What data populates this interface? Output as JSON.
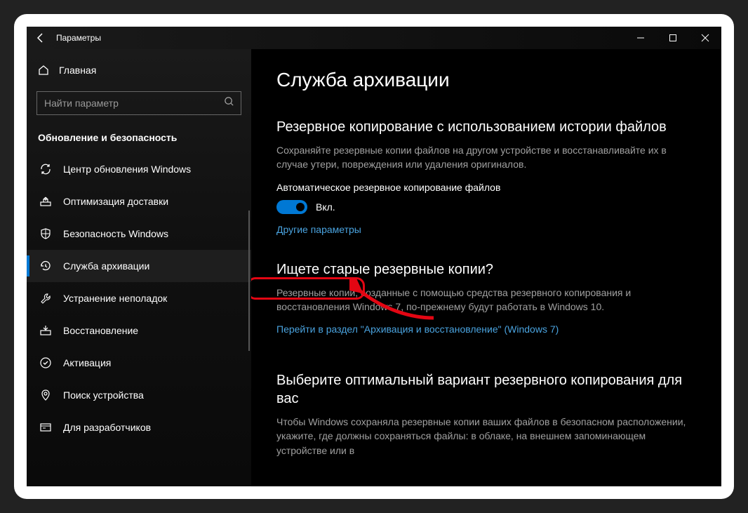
{
  "window": {
    "title": "Параметры"
  },
  "sidebar": {
    "home_label": "Главная",
    "search_placeholder": "Найти параметр",
    "category": "Обновление и безопасность",
    "items": [
      {
        "label": "Центр обновления Windows"
      },
      {
        "label": "Оптимизация доставки"
      },
      {
        "label": "Безопасность Windows"
      },
      {
        "label": "Служба архивации"
      },
      {
        "label": "Устранение неполадок"
      },
      {
        "label": "Восстановление"
      },
      {
        "label": "Активация"
      },
      {
        "label": "Поиск устройства"
      },
      {
        "label": "Для разработчиков"
      }
    ],
    "active_index": 3
  },
  "main": {
    "page_title": "Служба архивации",
    "section1": {
      "title": "Резервное копирование с использованием истории файлов",
      "desc": "Сохраняйте резервные копии файлов на другом устройстве и восстанавливайте их в случае утери, повреждения или удаления оригиналов.",
      "toggle_label": "Автоматическое резервное копирование файлов",
      "toggle_state": "Вкл.",
      "link": "Другие параметры"
    },
    "section2": {
      "title": "Ищете старые резервные копии?",
      "desc": "Резервные копии, созданные с помощью средства резервного копирования и восстановления Windows 7, по-прежнему будут работать в Windows 10.",
      "link": "Перейти в раздел \"Архивация и восстановление\" (Windows 7)"
    },
    "section3": {
      "title": "Выберите оптимальный вариант резервного копирования для вас",
      "desc": "Чтобы Windows сохраняла резервные копии ваших файлов в безопасном расположении, укажите, где должны сохраняться файлы: в облаке, на внешнем запоминающем устройстве или в"
    }
  },
  "annotation": {
    "highlight_target": "Другие параметры"
  }
}
